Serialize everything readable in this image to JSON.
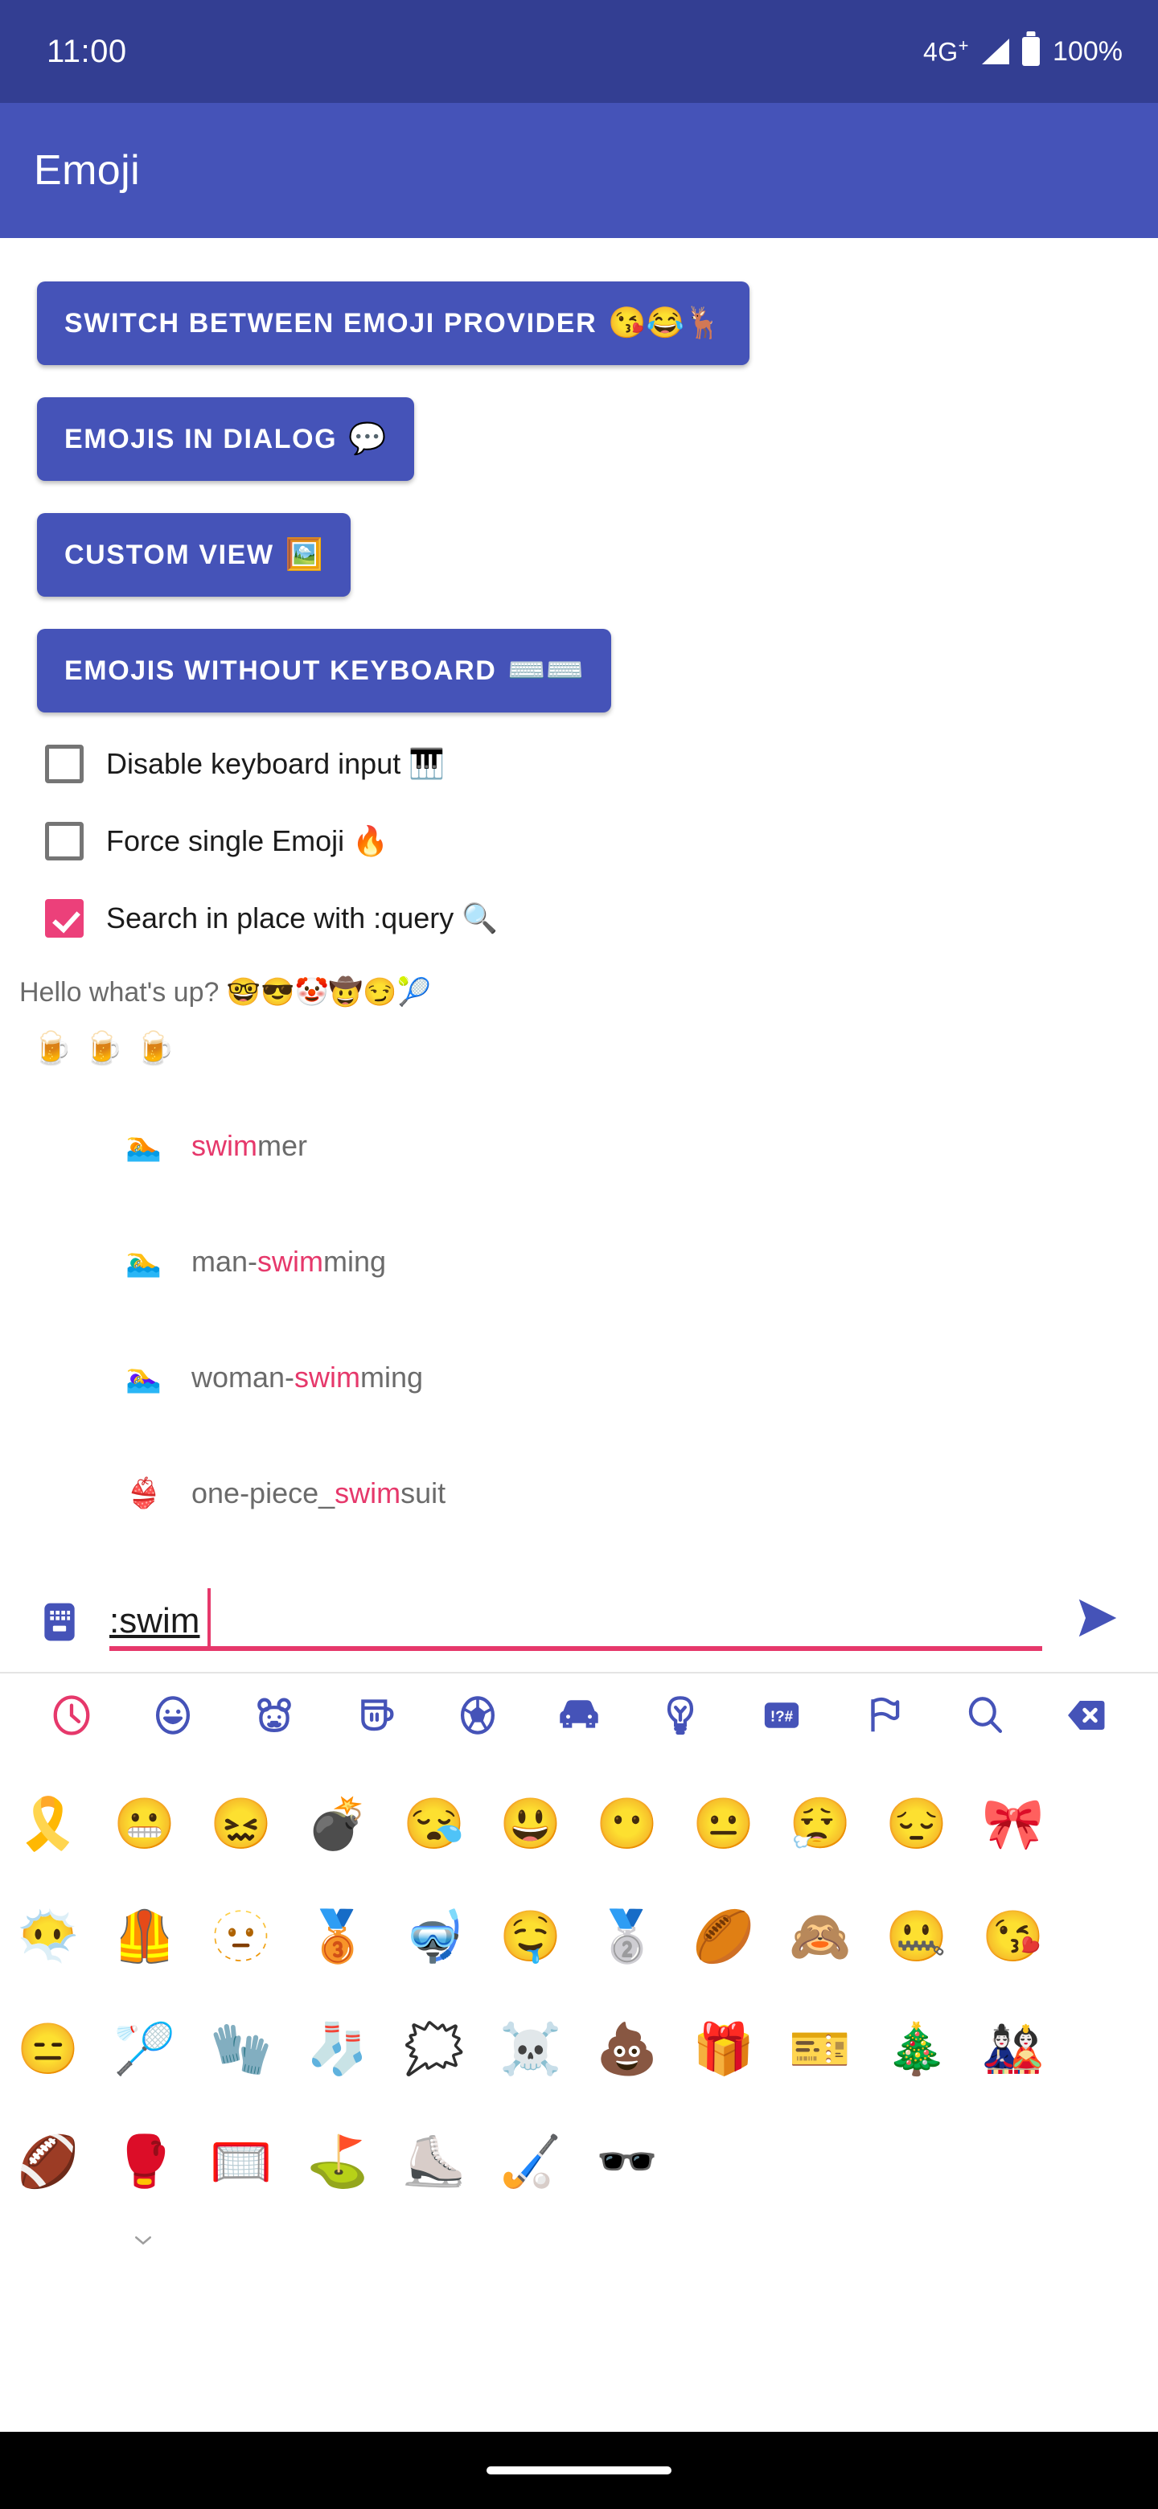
{
  "statusbar": {
    "time": "11:00",
    "network": "4G",
    "network_sup": "+",
    "battery_text": "100%",
    "signal_icon": "signal-triangle-icon",
    "battery_icon": "battery-full-icon"
  },
  "appbar": {
    "title": "Emoji"
  },
  "buttons": [
    {
      "label": "SWITCH BETWEEN EMOJI PROVIDER",
      "emoji": "😘😂🦌",
      "name": "switch-emoji-provider-button"
    },
    {
      "label": "EMOJIS IN DIALOG",
      "emoji": "💬",
      "name": "emojis-in-dialog-button"
    },
    {
      "label": "CUSTOM VIEW",
      "emoji": "🖼️",
      "name": "custom-view-button"
    },
    {
      "label": "EMOJIS WITHOUT KEYBOARD",
      "emoji": "⌨️⌨️",
      "name": "emojis-without-keyboard-button"
    }
  ],
  "checkboxes": [
    {
      "label": "Disable keyboard input 🎹",
      "checked": false,
      "name": "disable-keyboard-input-checkbox"
    },
    {
      "label": "Force single Emoji 🔥",
      "checked": false,
      "name": "force-single-emoji-checkbox"
    },
    {
      "label": "Search in place with :query 🔍",
      "checked": true,
      "name": "search-in-place-checkbox"
    }
  ],
  "sample": {
    "hello_text": "Hello what's up? 🤓😎🤡🤠😏🎾",
    "beers": "🍺🍺🍺"
  },
  "suggestions": [
    {
      "emoji": "🏊",
      "prefix": "",
      "match": "swim",
      "suffix": "mer"
    },
    {
      "emoji": "🏊‍♂️",
      "prefix": "man-",
      "match": "swim",
      "suffix": "ming"
    },
    {
      "emoji": "🏊‍♀️",
      "prefix": "woman-",
      "match": "swim",
      "suffix": "ming"
    },
    {
      "emoji": "👙",
      "prefix": "one-piece_",
      "match": "swim",
      "suffix": "suit"
    }
  ],
  "input": {
    "value": ":swim",
    "placeholder": "",
    "keyboard_icon": "keyboard-icon",
    "send_icon": "send-icon",
    "accent_color": "#e6386b"
  },
  "keyboard": {
    "accent_color": "#e6386b",
    "icon_color": "#4553b8",
    "tabs": [
      {
        "name": "tab-recent",
        "icon": "clock-icon",
        "selected": true
      },
      {
        "name": "tab-smileys",
        "icon": "smiley-icon",
        "selected": false
      },
      {
        "name": "tab-animals",
        "icon": "bear-face-icon",
        "selected": false
      },
      {
        "name": "tab-food",
        "icon": "cup-icon",
        "selected": false
      },
      {
        "name": "tab-sports",
        "icon": "soccer-ball-icon",
        "selected": false
      },
      {
        "name": "tab-travel",
        "icon": "car-icon",
        "selected": false
      },
      {
        "name": "tab-objects",
        "icon": "lightbulb-icon",
        "selected": false
      },
      {
        "name": "tab-symbols",
        "icon": "symbols-icon",
        "label": "!?#",
        "selected": false
      },
      {
        "name": "tab-flags",
        "icon": "flag-icon",
        "selected": false
      },
      {
        "name": "tab-search",
        "icon": "search-icon",
        "selected": false
      },
      {
        "name": "tab-backspace",
        "icon": "backspace-icon",
        "selected": false
      }
    ],
    "grid": [
      [
        "🎗️",
        "😬",
        "😖",
        "💣",
        "😪",
        "😃",
        "😶",
        "😐",
        "😮‍💨",
        "😔",
        "🎀"
      ],
      [
        "😶‍🌫️",
        "🦺",
        "🫥",
        "🥉",
        "🤿",
        "🤤",
        "🥈",
        "🏉",
        "🙈",
        "🤐",
        "😘"
      ],
      [
        "😑",
        "🏸",
        "🧤",
        "🧦",
        "🗯️",
        "☠️",
        "💩",
        "🎁",
        "🎫",
        "🎄",
        "🎎"
      ],
      [
        "🏈",
        "🥊",
        "🥅",
        "⛳",
        "⛸️",
        "🏑",
        "🕶️"
      ]
    ],
    "collapse_icon": "chevron-down-icon"
  },
  "navbar": {
    "home_indicator": "home-pill"
  }
}
